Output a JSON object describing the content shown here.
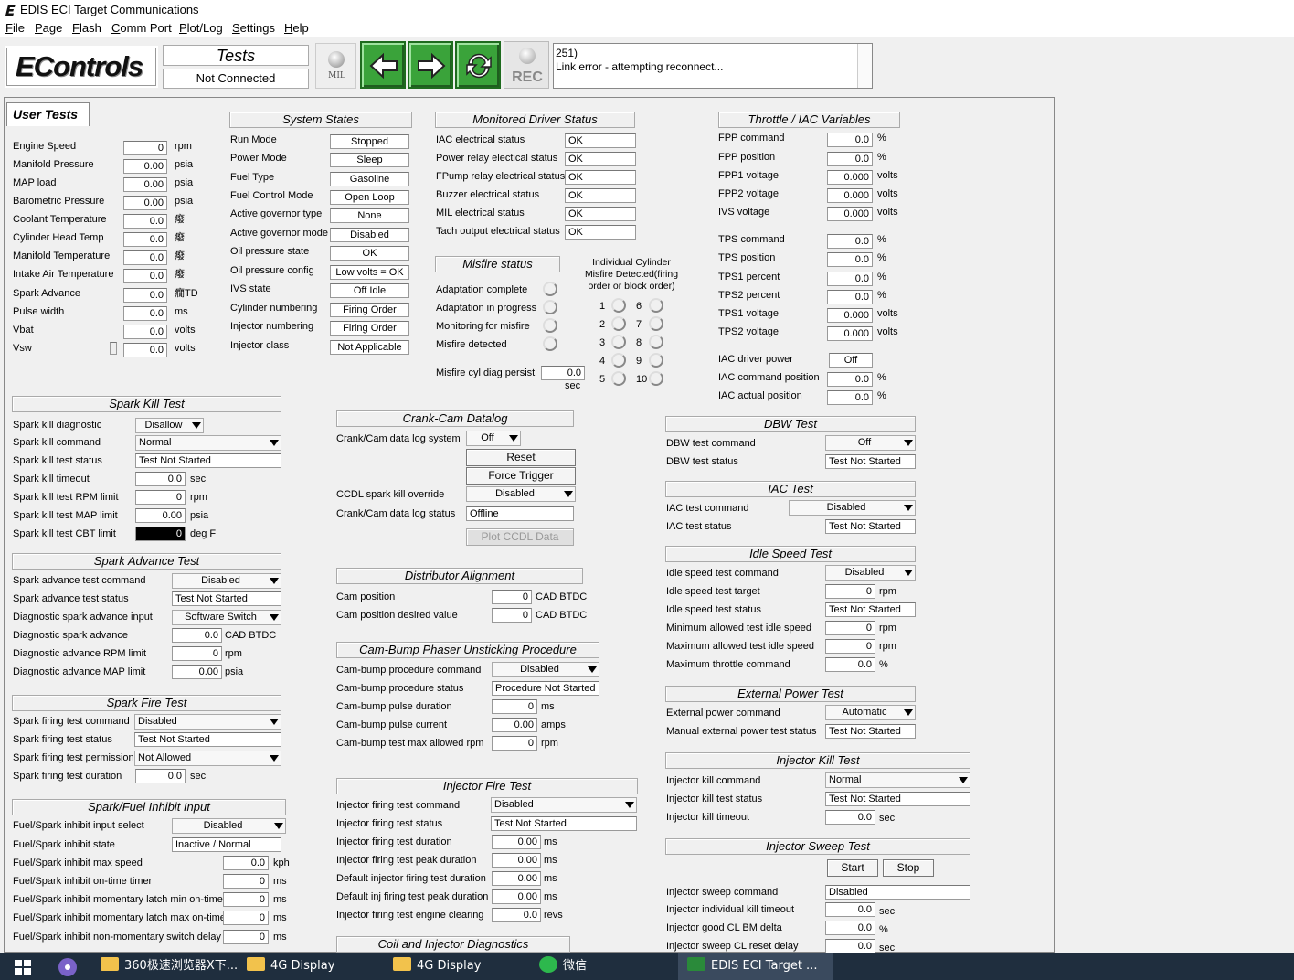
{
  "window": {
    "title": "EDIS ECI Target Communications"
  },
  "menu": [
    "File",
    "Page",
    "Flash",
    "Comm Port",
    "Plot/Log",
    "Settings",
    "Help"
  ],
  "toolbar": {
    "logo": "EControls",
    "tests": "Tests",
    "conn": "Not Connected",
    "mil": "MIL",
    "rec": "REC",
    "status_line1": "251)",
    "status_line2": "Link error - attempting reconnect..."
  },
  "tab": "User Tests",
  "left_vars": [
    {
      "label": "Engine Speed",
      "value": "0",
      "unit": "rpm"
    },
    {
      "label": "Manifold Pressure",
      "value": "0.00",
      "unit": "psia"
    },
    {
      "label": "MAP load",
      "value": "0.00",
      "unit": "psia"
    },
    {
      "label": "Barometric Pressure",
      "value": "0.00",
      "unit": "psia"
    },
    {
      "label": "Coolant Temperature",
      "value": "0.0",
      "unit": "癈"
    },
    {
      "label": "Cylinder Head Temp",
      "value": "0.0",
      "unit": "癈"
    },
    {
      "label": "Manifold Temperature",
      "value": "0.0",
      "unit": "癈"
    },
    {
      "label": "Intake Air Temperature",
      "value": "0.0",
      "unit": "癈"
    },
    {
      "label": "Spark Advance",
      "value": "0.0",
      "unit": "癇TD"
    },
    {
      "label": "Pulse width",
      "value": "0.0",
      "unit": "ms"
    },
    {
      "label": "Vbat",
      "value": "0.0",
      "unit": "volts"
    },
    {
      "label": "Vsw",
      "value": "0.0",
      "unit": "volts"
    }
  ],
  "system_states": {
    "title": "System States",
    "rows": [
      {
        "label": "Run Mode",
        "value": "Stopped"
      },
      {
        "label": "Power Mode",
        "value": "Sleep"
      },
      {
        "label": "Fuel Type",
        "value": "Gasoline"
      },
      {
        "label": "Fuel Control Mode",
        "value": "Open Loop"
      },
      {
        "label": "Active governor type",
        "value": "None"
      },
      {
        "label": "Active governor mode",
        "value": "Disabled"
      },
      {
        "label": "Oil pressure state",
        "value": "OK"
      },
      {
        "label": "Oil pressure config",
        "value": "Low volts = OK"
      },
      {
        "label": "IVS state",
        "value": "Off Idle"
      },
      {
        "label": "Cylinder numbering",
        "value": "Firing Order"
      },
      {
        "label": "Injector numbering",
        "value": "Firing Order"
      },
      {
        "label": "Injector class",
        "value": "Not Applicable"
      }
    ]
  },
  "monitored": {
    "title": "Monitored Driver Status",
    "rows": [
      {
        "label": "IAC electrical status",
        "value": "OK"
      },
      {
        "label": "Power relay electical status",
        "value": "OK"
      },
      {
        "label": "FPump relay electrical status",
        "value": "OK"
      },
      {
        "label": "Buzzer electrical status",
        "value": "OK"
      },
      {
        "label": "MIL electrical status",
        "value": "OK"
      },
      {
        "label": "Tach output electrical status",
        "value": "OK"
      }
    ]
  },
  "misfire": {
    "title": "Misfire status",
    "rows": [
      "Adaptation complete",
      "Adaptation in progress",
      "Monitoring for misfire",
      "Misfire detected"
    ],
    "individual_title": "Individual Cylinder Misfire Detected(firing order or block order)",
    "cyls": [
      "1",
      "2",
      "3",
      "4",
      "5",
      "6",
      "7",
      "8",
      "9",
      "10"
    ],
    "persist_label": "Misfire cyl diag persist",
    "persist_value": "0.0",
    "persist_unit": "sec"
  },
  "throttle": {
    "title": "Throttle / IAC Variables",
    "rows": [
      {
        "label": "FPP command",
        "value": "0.0",
        "unit": "%"
      },
      {
        "label": "FPP position",
        "value": "0.0",
        "unit": "%"
      },
      {
        "label": "FPP1 voltage",
        "value": "0.000",
        "unit": "volts"
      },
      {
        "label": "FPP2 voltage",
        "value": "0.000",
        "unit": "volts"
      },
      {
        "label": "IVS voltage",
        "value": "0.000",
        "unit": "volts"
      },
      {
        "label": "TPS command",
        "value": "0.0",
        "unit": "%"
      },
      {
        "label": "TPS position",
        "value": "0.0",
        "unit": "%"
      },
      {
        "label": "TPS1 percent",
        "value": "0.0",
        "unit": "%"
      },
      {
        "label": "TPS2 percent",
        "value": "0.0",
        "unit": "%"
      },
      {
        "label": "TPS1 voltage",
        "value": "0.000",
        "unit": "volts"
      },
      {
        "label": "TPS2 voltage",
        "value": "0.000",
        "unit": "volts"
      },
      {
        "label": "IAC driver power",
        "value": "Off",
        "unit": ""
      },
      {
        "label": "IAC command position",
        "value": "0.0",
        "unit": "%"
      },
      {
        "label": "IAC actual position",
        "value": "0.0",
        "unit": "%"
      }
    ]
  },
  "spark_kill": {
    "title": "Spark Kill Test",
    "rows": [
      {
        "label": "Spark kill diagnostic",
        "value": "Disallow"
      },
      {
        "label": "Spark kill command",
        "value": "Normal"
      },
      {
        "label": "Spark kill test status",
        "value": "Test Not Started"
      },
      {
        "label": "Spark kill timeout",
        "value": "0.0",
        "unit": "sec"
      },
      {
        "label": "Spark kill test RPM limit",
        "value": "0",
        "unit": "rpm"
      },
      {
        "label": "Spark kill test MAP limit",
        "value": "0.00",
        "unit": "psia"
      },
      {
        "label": "Spark kill test CBT limit",
        "value": "0",
        "unit": "deg F"
      }
    ]
  },
  "spark_adv": {
    "title": "Spark Advance Test",
    "rows": [
      {
        "label": "Spark advance test command",
        "value": "Disabled"
      },
      {
        "label": "Spark advance test status",
        "value": "Test Not Started"
      },
      {
        "label": "Diagnostic spark advance input",
        "value": "Software Switch"
      },
      {
        "label": "Diagnostic spark advance",
        "value": "0.0",
        "unit": "CAD BTDC"
      },
      {
        "label": "Diagnostic advance RPM limit",
        "value": "0",
        "unit": "rpm"
      },
      {
        "label": "Diagnostic advance MAP limit",
        "value": "0.00",
        "unit": "psia"
      }
    ]
  },
  "spark_fire": {
    "title": "Spark Fire Test",
    "rows": [
      {
        "label": "Spark firing test command",
        "value": "Disabled"
      },
      {
        "label": "Spark firing test status",
        "value": "Test Not Started"
      },
      {
        "label": "Spark firing test permission",
        "value": "Not Allowed"
      },
      {
        "label": "Spark firing test duration",
        "value": "0.0",
        "unit": "sec"
      }
    ]
  },
  "inhibit": {
    "title": "Spark/Fuel Inhibit Input",
    "rows": [
      {
        "label": "Fuel/Spark inhibit input select",
        "value": "Disabled"
      },
      {
        "label": "Fuel/Spark inhibit state",
        "value": "Inactive / Normal"
      },
      {
        "label": "Fuel/Spark inhibit max speed",
        "value": "0.0",
        "unit": "kph"
      },
      {
        "label": "Fuel/Spark inhibit on-time timer",
        "value": "0",
        "unit": "ms"
      },
      {
        "label": "Fuel/Spark inhibit momentary latch min on-time",
        "value": "0",
        "unit": "ms"
      },
      {
        "label": "Fuel/Spark inhibit momentary latch max on-time",
        "value": "0",
        "unit": "ms"
      },
      {
        "label": "Fuel/Spark inhibit non-momentary switch delay",
        "value": "0",
        "unit": "ms"
      }
    ]
  },
  "crank_cam": {
    "title": "Crank-Cam Datalog",
    "system_label": "Crank/Cam data log system",
    "system_value": "Off",
    "reset": "Reset",
    "force": "Force Trigger",
    "ccdl_label": "CCDL spark kill override",
    "ccdl_value": "Disabled",
    "status_label": "Crank/Cam data log status",
    "status_value": "Offline",
    "plot": "Plot CCDL Data"
  },
  "distributor": {
    "title": "Distributor Alignment",
    "rows": [
      {
        "label": "Cam position",
        "value": "0",
        "unit": "CAD BTDC"
      },
      {
        "label": "Cam position desired value",
        "value": "0",
        "unit": "CAD BTDC"
      }
    ]
  },
  "cam_bump": {
    "title": "Cam-Bump Phaser Unsticking Procedure",
    "rows": [
      {
        "label": "Cam-bump procedure command",
        "value": "Disabled"
      },
      {
        "label": "Cam-bump procedure status",
        "value": "Procedure Not Started"
      },
      {
        "label": "Cam-bump pulse duration",
        "value": "0",
        "unit": "ms"
      },
      {
        "label": "Cam-bump pulse current",
        "value": "0.00",
        "unit": "amps"
      },
      {
        "label": "Cam-bump test max allowed rpm",
        "value": "0",
        "unit": "rpm"
      }
    ]
  },
  "inj_fire": {
    "title": "Injector Fire Test",
    "rows": [
      {
        "label": "Injector firing test command",
        "value": "Disabled"
      },
      {
        "label": "Injector firing test status",
        "value": "Test Not Started"
      },
      {
        "label": "Injector firing test duration",
        "value": "0.00",
        "unit": "ms"
      },
      {
        "label": "Injector firing test peak duration",
        "value": "0.00",
        "unit": "ms"
      },
      {
        "label": "Default injector firing test duration",
        "value": "0.00",
        "unit": "ms"
      },
      {
        "label": "Default inj firing test peak duration",
        "value": "0.00",
        "unit": "ms"
      },
      {
        "label": "Injector firing test engine clearing",
        "value": "0.0",
        "unit": "revs"
      }
    ]
  },
  "coil_diag": {
    "title": "Coil and Injector Diagnostics"
  },
  "dbw": {
    "title": "DBW Test",
    "rows": [
      {
        "label": "DBW test command",
        "value": "Off"
      },
      {
        "label": "DBW test status",
        "value": "Test Not Started"
      }
    ]
  },
  "iac_test": {
    "title": "IAC Test",
    "rows": [
      {
        "label": "IAC test command",
        "value": "Disabled"
      },
      {
        "label": "IAC test status",
        "value": "Test Not Started"
      }
    ]
  },
  "idle": {
    "title": "Idle Speed Test",
    "rows": [
      {
        "label": "Idle speed test command",
        "value": "Disabled"
      },
      {
        "label": "Idle speed test target",
        "value": "0",
        "unit": "rpm"
      },
      {
        "label": "Idle speed test status",
        "value": "Test Not Started"
      },
      {
        "label": "Minimum allowed test idle speed",
        "value": "0",
        "unit": "rpm"
      },
      {
        "label": "Maximum allowed test idle speed",
        "value": "0",
        "unit": "rpm"
      },
      {
        "label": "Maximum throttle command",
        "value": "0.0",
        "unit": "%"
      }
    ]
  },
  "ext_power": {
    "title": "External Power Test",
    "rows": [
      {
        "label": "External power command",
        "value": "Automatic"
      },
      {
        "label": "Manual external power test status",
        "value": "Test Not Started"
      }
    ]
  },
  "inj_kill": {
    "title": "Injector Kill Test",
    "rows": [
      {
        "label": "Injector kill command",
        "value": "Normal"
      },
      {
        "label": "Injector kill test status",
        "value": "Test Not Started"
      },
      {
        "label": "Injector kill timeout",
        "value": "0.0",
        "unit": "sec"
      }
    ]
  },
  "inj_sweep": {
    "title": "Injector Sweep Test",
    "start": "Start",
    "stop": "Stop",
    "rows": [
      {
        "label": "Injector sweep command",
        "value": "Disabled"
      },
      {
        "label": "Injector individual kill timeout",
        "value": "0.0",
        "unit": "sec"
      },
      {
        "label": "Injector good CL BM delta",
        "value": "0.0",
        "unit": "%"
      },
      {
        "label": "Injector sweep CL reset delay",
        "value": "0.0",
        "unit": "sec"
      }
    ]
  },
  "taskbar": {
    "items": [
      "360极速浏览器X下...",
      "4G Display",
      "4G Display",
      "微信",
      "EDIS ECI Target ..."
    ]
  }
}
